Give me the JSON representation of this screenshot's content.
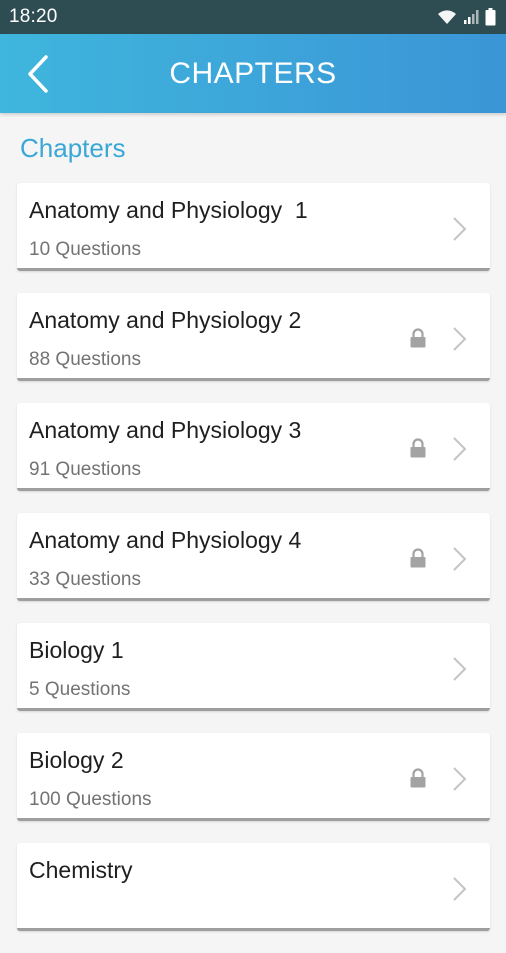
{
  "status_bar": {
    "time": "18:20",
    "icons": [
      "wifi-icon",
      "cellular-signal-icon",
      "battery-icon"
    ]
  },
  "app_bar": {
    "title": "CHAPTERS",
    "back_icon": "chevron-left-icon"
  },
  "section": {
    "heading": "Chapters"
  },
  "chapters": [
    {
      "title": "Anatomy and Physiology  1",
      "subtitle": "10 Questions",
      "locked": false
    },
    {
      "title": "Anatomy and Physiology 2",
      "subtitle": "88 Questions",
      "locked": true
    },
    {
      "title": "Anatomy and Physiology 3",
      "subtitle": "91 Questions",
      "locked": true
    },
    {
      "title": "Anatomy and Physiology 4",
      "subtitle": "33 Questions",
      "locked": true
    },
    {
      "title": "Biology 1",
      "subtitle": "5 Questions",
      "locked": false
    },
    {
      "title": "Biology 2",
      "subtitle": "100 Questions",
      "locked": true
    },
    {
      "title": "Chemistry",
      "subtitle": "",
      "locked": false
    }
  ],
  "colors": {
    "status_bar_bg": "#2e4d52",
    "app_bar_gradient_start": "#3fb6dd",
    "app_bar_gradient_end": "#3b95d6",
    "accent": "#3aa7d6",
    "page_bg": "#f5f5f5",
    "lock_icon": "#a3a3a3",
    "chevron_icon": "#c4c4c4"
  }
}
